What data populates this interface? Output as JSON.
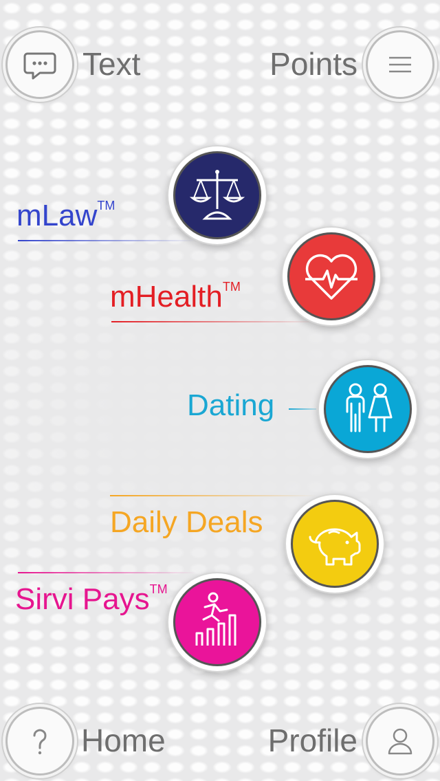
{
  "header": {
    "left_label": "Text",
    "right_label": "Points"
  },
  "footer": {
    "left_label": "Home",
    "right_label": "Profile"
  },
  "apps": [
    {
      "label": "mLaw",
      "tm": "TM",
      "color": "#2233aa",
      "icon": "scales-icon"
    },
    {
      "label": "mHealth",
      "tm": "TM",
      "color": "#e31e24",
      "icon": "heart-pulse-icon"
    },
    {
      "label": "Dating",
      "tm": "",
      "color": "#1aa7d3",
      "icon": "couple-icon"
    },
    {
      "label": "Daily Deals",
      "tm": "",
      "color": "#f5a623",
      "icon": "piggy-bank-icon"
    },
    {
      "label": "Sirvi Pays",
      "tm": "TM",
      "color": "#e6158f",
      "icon": "climbing-chart-icon"
    }
  ],
  "colors": {
    "mlaw_circle": "#26296b",
    "mhealth_circle": "#e83a3a",
    "dating_circle": "#0aa7d6",
    "deals_circle": "#f3cc10",
    "pays_circle": "#ea149a",
    "corner_text": "#6e6e6e"
  }
}
